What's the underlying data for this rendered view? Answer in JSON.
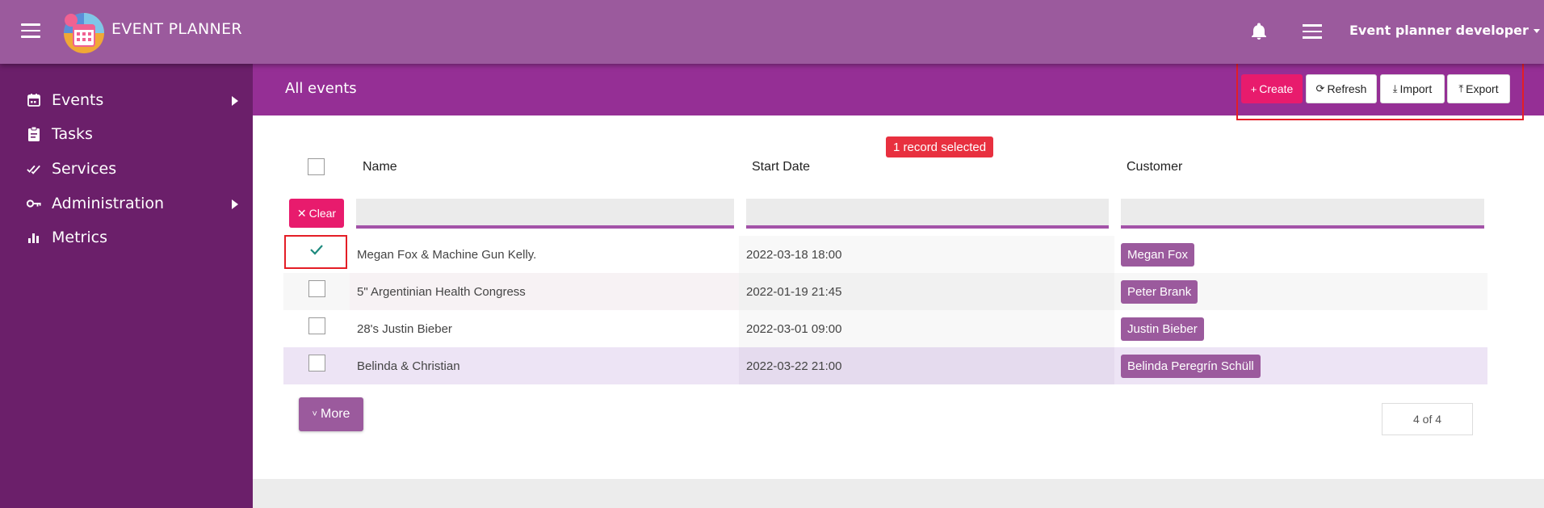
{
  "app": {
    "title": "EVENT PLANNER"
  },
  "topbar": {
    "user_menu_label": "Event planner developer"
  },
  "sidebar": {
    "items": [
      {
        "label": "Events",
        "icon": "calendar-icon",
        "has_submenu": true
      },
      {
        "label": "Tasks",
        "icon": "clipboard-icon",
        "has_submenu": false
      },
      {
        "label": "Services",
        "icon": "double-check-icon",
        "has_submenu": false
      },
      {
        "label": "Administration",
        "icon": "key-icon",
        "has_submenu": true
      },
      {
        "label": "Metrics",
        "icon": "bar-chart-icon",
        "has_submenu": false
      }
    ]
  },
  "header": {
    "title": "All events"
  },
  "toolbar": {
    "create_label": "Create",
    "refresh_label": "Refresh",
    "import_label": "Import",
    "export_label": "Export"
  },
  "selection": {
    "badge_text": "1 record selected",
    "clear_label": "Clear"
  },
  "table": {
    "columns": [
      "Name",
      "Start Date",
      "Customer"
    ],
    "rows": [
      {
        "name": "Megan Fox & Machine Gun Kelly.",
        "start_date": "2022-03-18 18:00",
        "customer": "Megan Fox",
        "selected": true
      },
      {
        "name": "5\" Argentinian Health Congress",
        "start_date": "2022-01-19 21:45",
        "customer": "Peter Brank",
        "selected": false
      },
      {
        "name": "28's Justin Bieber",
        "start_date": "2022-03-01 09:00",
        "customer": "Justin Bieber",
        "selected": false
      },
      {
        "name": "Belinda & Christian",
        "start_date": "2022-03-22 21:00",
        "customer": "Belinda Peregrín Schüll",
        "selected": false
      }
    ]
  },
  "more_label": "More",
  "pager_text": "4 of 4",
  "colors": {
    "topbar": "#9b5a9d",
    "sidebar": "#6b1f6a",
    "header_band": "#952f95",
    "accent_pink": "#e81b6d",
    "badge_red": "#e8303f",
    "highlight_red": "#e41e26",
    "check_teal": "#1e8a7e"
  }
}
